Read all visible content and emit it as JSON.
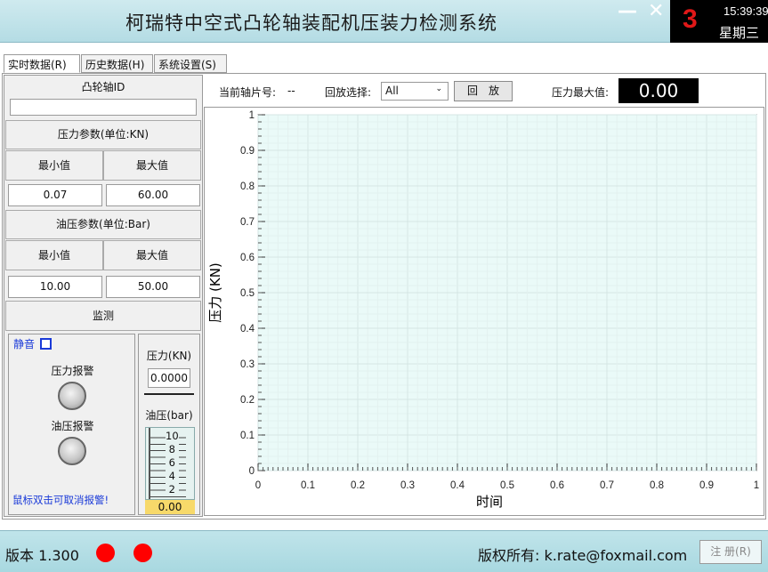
{
  "app": {
    "title": "柯瑞特中空式凸轮轴装配机压装力检测系统"
  },
  "window": {
    "minimize": "—",
    "close": "✕"
  },
  "clock": {
    "number": "3",
    "time": "15:39:39",
    "weekday": "星期三"
  },
  "tabs": [
    "实时数据(R)",
    "历史数据(H)",
    "系统设置(S)"
  ],
  "left": {
    "camshaft_id_label": "凸轮轴ID",
    "camshaft_id_value": "",
    "pressure_param_label": "压力参数(单位:KN)",
    "pressure_min_label": "最小值",
    "pressure_max_label": "最大值",
    "pressure_min": "0.07",
    "pressure_max": "60.00",
    "oil_param_label": "油压参数(单位:Bar)",
    "oil_min_label": "最小值",
    "oil_max_label": "最大值",
    "oil_min": "10.00",
    "oil_max": "50.00",
    "monitor_label": "监测",
    "mute_label": "静音",
    "pressure_alarm_label": "压力报警",
    "oil_alarm_label": "油压报警",
    "cancel_alarm_hint": "鼠标双击可取消报警!",
    "pressure_kn_label": "压力(KN)",
    "pressure_kn_value": "0.0000",
    "oil_bar_label": "油压(bar)",
    "gauge_ticks": [
      "10",
      "8",
      "6",
      "4",
      "2"
    ],
    "gauge_value": "0.00"
  },
  "topbar": {
    "current_shaft_label": "当前轴片号:",
    "current_shaft_value": "--",
    "replay_select_label": "回放选择:",
    "replay_selected": "All",
    "replay_button": "回　放",
    "max_pressure_label": "压力最大值:",
    "max_pressure_value": "0.00"
  },
  "chart_data": {
    "type": "line",
    "xlabel": "时间",
    "ylabel": "压力  (KN)",
    "xlim": [
      0,
      1
    ],
    "ylim": [
      0,
      1
    ],
    "x_ticks": [
      "0",
      "0.1",
      "0.2",
      "0.3",
      "0.4",
      "0.5",
      "0.6",
      "0.7",
      "0.8",
      "0.9",
      "1"
    ],
    "y_ticks": [
      "0",
      "0.1",
      "0.2",
      "0.3",
      "0.4",
      "0.5",
      "0.6",
      "0.7",
      "0.8",
      "0.9",
      "1"
    ],
    "series": [],
    "grid": true,
    "plot_bg": "#eafaf8"
  },
  "status": {
    "version": "版本 1.300",
    "copyright": "版权所有: k.rate@foxmail.com",
    "register": "注 册(R)",
    "led_color": "#ff0000"
  }
}
